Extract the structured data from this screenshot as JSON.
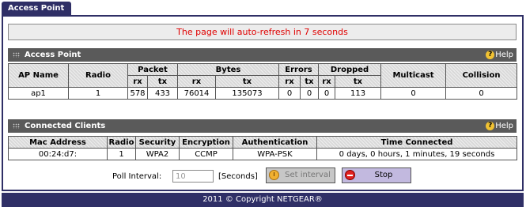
{
  "tab": {
    "title": "Access Point"
  },
  "refresh_message": "The page will auto-refresh in 7 seconds",
  "help_label": "Help",
  "ap_section": {
    "title": "Access Point",
    "headers": {
      "ap_name": "AP Name",
      "radio": "Radio",
      "packet": "Packet",
      "bytes": "Bytes",
      "errors": "Errors",
      "dropped": "Dropped",
      "multicast": "Multicast",
      "collision": "Collision",
      "rx": "rx",
      "tx": "tx"
    },
    "rows": [
      {
        "ap_name": "ap1",
        "radio": "1",
        "packet_rx": "578",
        "packet_tx": "433",
        "bytes_rx": "76014",
        "bytes_tx": "135073",
        "errors_rx": "0",
        "errors_tx": "0",
        "dropped_rx": "0",
        "dropped_tx": "113",
        "multicast": "0",
        "collision": "0"
      }
    ]
  },
  "clients_section": {
    "title": "Connected Clients",
    "headers": {
      "mac": "Mac Address",
      "radio": "Radio",
      "security": "Security",
      "encryption": "Encryption",
      "authentication": "Authentication",
      "time": "Time Connected"
    },
    "rows": [
      {
        "mac": "00:24:d7:",
        "radio": "1",
        "security": "WPA2",
        "encryption": "CCMP",
        "authentication": "WPA-PSK",
        "time": "0 days, 0 hours, 1 minutes, 19 seconds"
      }
    ]
  },
  "poll": {
    "label": "Poll Interval:",
    "value": "10",
    "unit": "[Seconds]"
  },
  "buttons": {
    "set_interval": "Set interval",
    "stop": "Stop"
  },
  "footer": "2011 © Copyright NETGEAR®",
  "colors": {
    "tab": "#2f2f66",
    "section_bar": "#5a5a5a",
    "refresh_text": "#e00000",
    "stop_button": "#c2b9df"
  },
  "icons": {
    "help": "help-icon",
    "grip": "grip-icon",
    "set_interval": "clock-icon",
    "stop": "stop-icon"
  }
}
